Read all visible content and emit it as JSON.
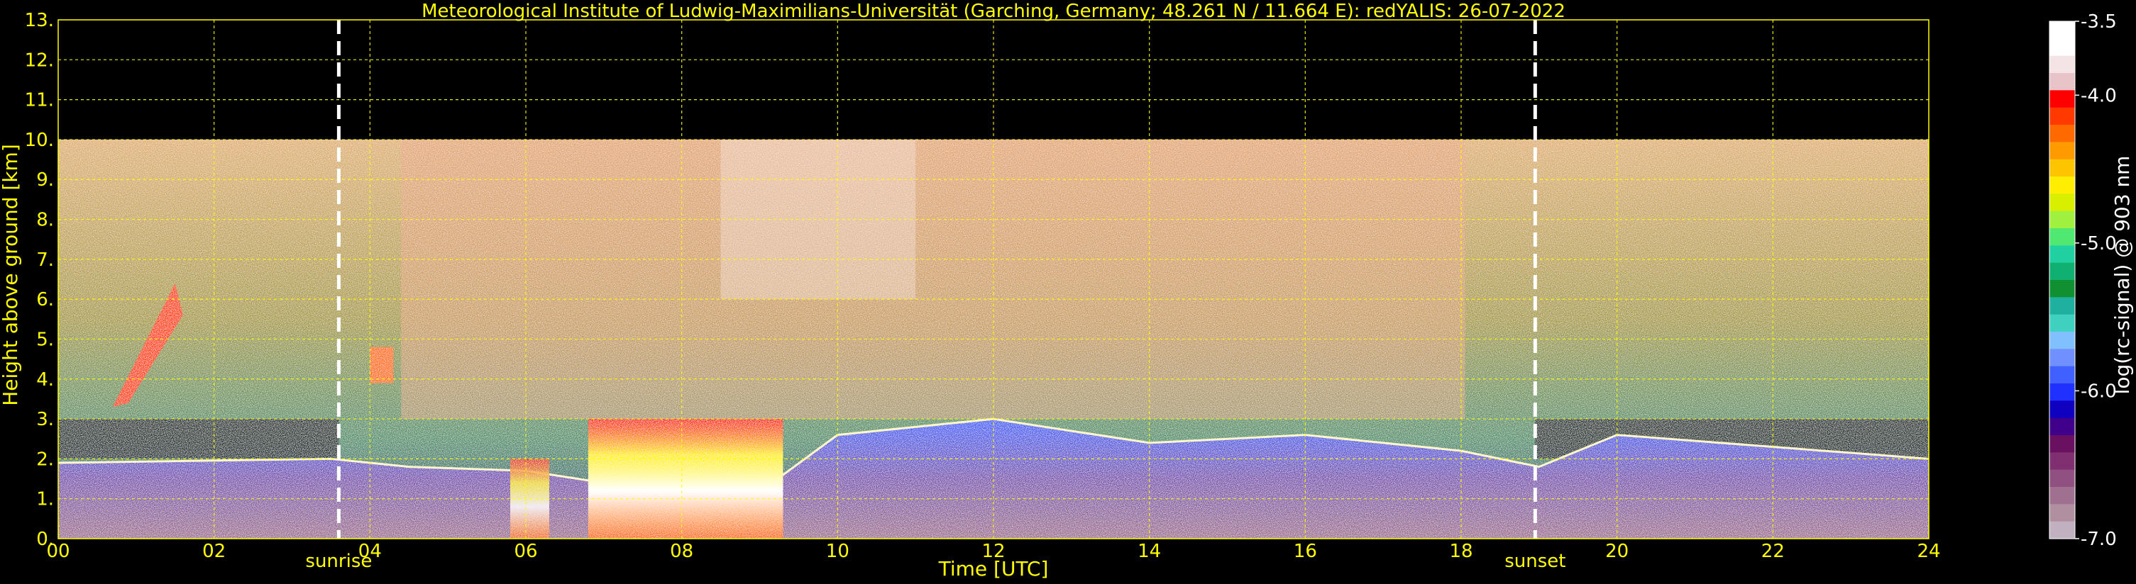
{
  "chart_data": {
    "type": "heatmap",
    "title": "Meteorological Institute of Ludwig-Maximilians-Universität (Garching, Germany; 48.261 N / 11.664 E):    redYALIS: 26-07-2022",
    "xlabel": "Time [UTC]",
    "ylabel": "Height above ground [km]",
    "xlim": [
      0,
      24
    ],
    "ylim": [
      0,
      13
    ],
    "x_ticks": [
      "00",
      "02",
      "04",
      "06",
      "08",
      "10",
      "12",
      "14",
      "16",
      "18",
      "20",
      "22",
      "24"
    ],
    "y_ticks": [
      "0.",
      "1.",
      "2.",
      "3.",
      "4.",
      "5.",
      "6.",
      "7.",
      "8.",
      "9.",
      "10.",
      "11.",
      "12.",
      "13."
    ],
    "grid": true,
    "data_top_km": 10,
    "events": [
      {
        "label": "sunrise",
        "time_utc": 3.6
      },
      {
        "label": "sunset",
        "time_utc": 18.95
      }
    ],
    "colorbar": {
      "label": "log(rc-signal) @ 903 nm",
      "range": [
        -7.0,
        -3.5
      ],
      "ticks": [
        "-3.5",
        "-4.0",
        "-5.0",
        "-6.0",
        "-7.0"
      ],
      "tick_values": [
        -3.5,
        -4.0,
        -5.0,
        -6.0,
        -7.0
      ],
      "palette": [
        "#ffffff",
        "#ffffff",
        "#f4e4e6",
        "#e8c4c8",
        "#ff0000",
        "#ff3a00",
        "#ff6a00",
        "#ff9a00",
        "#ffc400",
        "#ffee00",
        "#d8f000",
        "#a0f040",
        "#50e870",
        "#20d0a0",
        "#10b070",
        "#109030",
        "#20b0a0",
        "#40d0c0",
        "#80c0ff",
        "#7090ff",
        "#4060ff",
        "#2030ff",
        "#1000c0",
        "#40008a",
        "#6a1060",
        "#803070",
        "#905080",
        "#a07090",
        "#b090a0",
        "#c0b0c0"
      ]
    },
    "encoding": "time-height cross-section of lidar backscatter signal (log scale)",
    "features": [
      {
        "feature": "boundary layer top",
        "time_range_utc": [
          0,
          24
        ],
        "height_km": [
          1.8,
          3.2
        ]
      },
      {
        "feature": "low clouds / strong return",
        "time_range_utc": [
          6.8,
          9.3
        ],
        "height_km": [
          0,
          3.0
        ]
      },
      {
        "feature": "elevated aerosol / cloud streak",
        "time_range_utc": [
          0.6,
          1.6
        ],
        "height_km": [
          3.3,
          6.4
        ]
      }
    ]
  }
}
